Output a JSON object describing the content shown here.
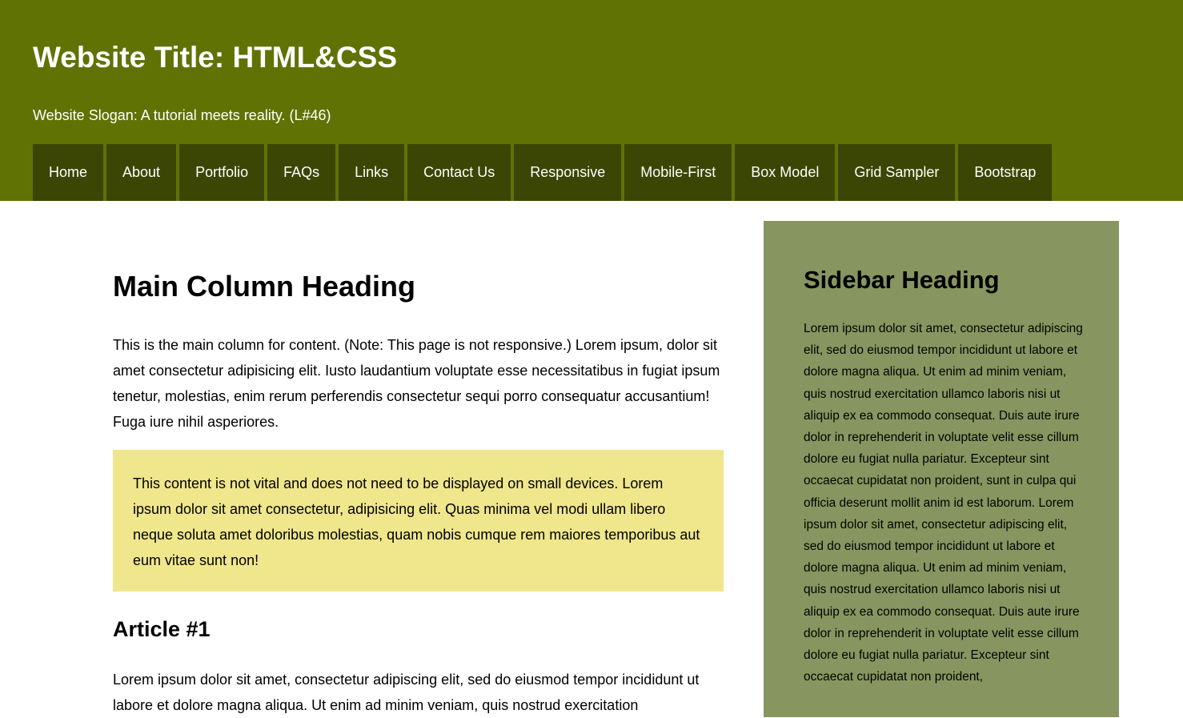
{
  "header": {
    "title": "Website Title: HTML&CSS",
    "slogan": "Website Slogan: A tutorial meets reality. (L#46)",
    "background": "#617204"
  },
  "nav": {
    "background": "#3b4605",
    "items": [
      {
        "label": "Home"
      },
      {
        "label": "About"
      },
      {
        "label": "Portfolio"
      },
      {
        "label": "FAQs"
      },
      {
        "label": "Links"
      },
      {
        "label": "Contact Us"
      },
      {
        "label": "Responsive"
      },
      {
        "label": "Mobile-First"
      },
      {
        "label": "Box Model"
      },
      {
        "label": "Grid Sampler"
      },
      {
        "label": "Bootstrap"
      }
    ]
  },
  "main": {
    "heading": "Main Column Heading",
    "intro": "This is the main column for content. (Note: This page is not responsive.) Lorem ipsum, dolor sit amet consectetur adipisicing elit. Iusto laudantium voluptate esse necessitatibus in fugiat ipsum tenetur, molestias, enim rerum perferendis consectetur sequi porro consequatur accusantium! Fuga iure nihil asperiores.",
    "note": "This content is not vital and does not need to be displayed on small devices. Lorem ipsum dolor sit amet consectetur, adipisicing elit. Quas minima vel modi ullam libero neque soluta amet doloribus molestias, quam nobis cumque rem maiores temporibus aut eum vitae sunt non!",
    "note_background": "#f0e68c",
    "article_heading": "Article #1",
    "article_text": "Lorem ipsum dolor sit amet, consectetur adipiscing elit, sed do eiusmod tempor incididunt ut labore et dolore magna aliqua. Ut enim ad minim veniam, quis nostrud exercitation"
  },
  "sidebar": {
    "heading": "Sidebar Heading",
    "text": "Lorem ipsum dolor sit amet, consectetur adipiscing elit, sed do eiusmod tempor incididunt ut labore et dolore magna aliqua. Ut enim ad minim veniam, quis nostrud exercitation ullamco laboris nisi ut aliquip ex ea commodo consequat. Duis aute irure dolor in reprehenderit in voluptate velit esse cillum dolore eu fugiat nulla pariatur. Excepteur sint occaecat cupidatat non proident, sunt in culpa qui officia deserunt mollit anim id est laborum. Lorem ipsum dolor sit amet, consectetur adipiscing elit, sed do eiusmod tempor incididunt ut labore et dolore magna aliqua. Ut enim ad minim veniam, quis nostrud exercitation ullamco laboris nisi ut aliquip ex ea commodo consequat. Duis aute irure dolor in reprehenderit in voluptate velit esse cillum dolore eu fugiat nulla pariatur. Excepteur sint occaecat cupidatat non proident,",
    "background": "#879660"
  }
}
